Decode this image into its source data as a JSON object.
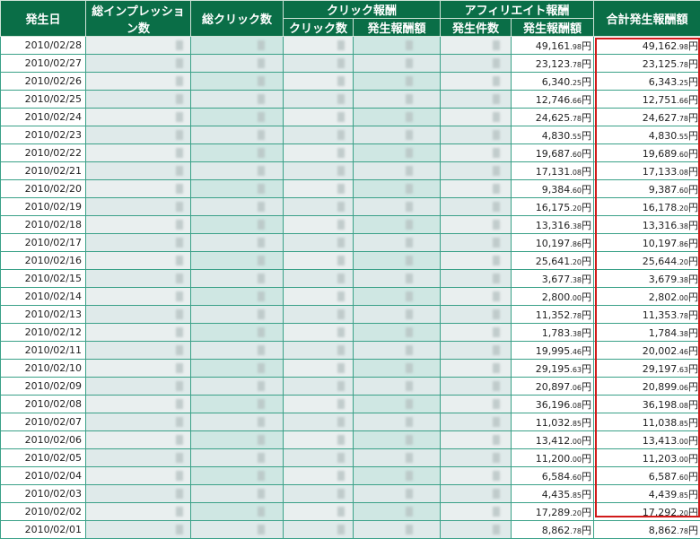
{
  "headers": {
    "date": "発生日",
    "impressions": "総インプレッション数",
    "clicks": "総クリック数",
    "click_reward": "クリック報酬",
    "click_count": "クリック数",
    "click_amount": "発生報酬額",
    "affiliate_reward": "アフィリエイト報酬",
    "affiliate_count": "発生件数",
    "affiliate_amount": "発生報酬額",
    "total_amount": "合計発生報酬額"
  },
  "currency": "円",
  "rows": [
    {
      "date": "2010/02/28",
      "aff_int": "49,161",
      "aff_dec": ".98",
      "tot_int": "49,162",
      "tot_dec": ".98"
    },
    {
      "date": "2010/02/27",
      "aff_int": "23,123",
      "aff_dec": ".78",
      "tot_int": "23,125",
      "tot_dec": ".78"
    },
    {
      "date": "2010/02/26",
      "aff_int": "6,340",
      "aff_dec": ".25",
      "tot_int": "6,343",
      "tot_dec": ".25"
    },
    {
      "date": "2010/02/25",
      "aff_int": "12,746",
      "aff_dec": ".66",
      "tot_int": "12,751",
      "tot_dec": ".66"
    },
    {
      "date": "2010/02/24",
      "aff_int": "24,625",
      "aff_dec": ".78",
      "tot_int": "24,627",
      "tot_dec": ".78"
    },
    {
      "date": "2010/02/23",
      "aff_int": "4,830",
      "aff_dec": ".55",
      "tot_int": "4,830",
      "tot_dec": ".55"
    },
    {
      "date": "2010/02/22",
      "aff_int": "19,687",
      "aff_dec": ".60",
      "tot_int": "19,689",
      "tot_dec": ".60"
    },
    {
      "date": "2010/02/21",
      "aff_int": "17,131",
      "aff_dec": ".08",
      "tot_int": "17,133",
      "tot_dec": ".08"
    },
    {
      "date": "2010/02/20",
      "aff_int": "9,384",
      "aff_dec": ".60",
      "tot_int": "9,387",
      "tot_dec": ".60"
    },
    {
      "date": "2010/02/19",
      "aff_int": "16,175",
      "aff_dec": ".20",
      "tot_int": "16,178",
      "tot_dec": ".20"
    },
    {
      "date": "2010/02/18",
      "aff_int": "13,316",
      "aff_dec": ".38",
      "tot_int": "13,316",
      "tot_dec": ".38"
    },
    {
      "date": "2010/02/17",
      "aff_int": "10,197",
      "aff_dec": ".86",
      "tot_int": "10,197",
      "tot_dec": ".86"
    },
    {
      "date": "2010/02/16",
      "aff_int": "25,641",
      "aff_dec": ".20",
      "tot_int": "25,644",
      "tot_dec": ".20"
    },
    {
      "date": "2010/02/15",
      "aff_int": "3,677",
      "aff_dec": ".38",
      "tot_int": "3,679",
      "tot_dec": ".38"
    },
    {
      "date": "2010/02/14",
      "aff_int": "2,800",
      "aff_dec": ".00",
      "tot_int": "2,802",
      "tot_dec": ".00"
    },
    {
      "date": "2010/02/13",
      "aff_int": "11,352",
      "aff_dec": ".78",
      "tot_int": "11,353",
      "tot_dec": ".78"
    },
    {
      "date": "2010/02/12",
      "aff_int": "1,783",
      "aff_dec": ".38",
      "tot_int": "1,784",
      "tot_dec": ".38"
    },
    {
      "date": "2010/02/11",
      "aff_int": "19,995",
      "aff_dec": ".46",
      "tot_int": "20,002",
      "tot_dec": ".46"
    },
    {
      "date": "2010/02/10",
      "aff_int": "29,195",
      "aff_dec": ".63",
      "tot_int": "29,197",
      "tot_dec": ".63"
    },
    {
      "date": "2010/02/09",
      "aff_int": "20,897",
      "aff_dec": ".06",
      "tot_int": "20,899",
      "tot_dec": ".06"
    },
    {
      "date": "2010/02/08",
      "aff_int": "36,196",
      "aff_dec": ".08",
      "tot_int": "36,198",
      "tot_dec": ".08"
    },
    {
      "date": "2010/02/07",
      "aff_int": "11,032",
      "aff_dec": ".85",
      "tot_int": "11,038",
      "tot_dec": ".85"
    },
    {
      "date": "2010/02/06",
      "aff_int": "13,412",
      "aff_dec": ".00",
      "tot_int": "13,413",
      "tot_dec": ".00"
    },
    {
      "date": "2010/02/05",
      "aff_int": "11,200",
      "aff_dec": ".00",
      "tot_int": "11,203",
      "tot_dec": ".00"
    },
    {
      "date": "2010/02/04",
      "aff_int": "6,584",
      "aff_dec": ".60",
      "tot_int": "6,587",
      "tot_dec": ".60"
    },
    {
      "date": "2010/02/03",
      "aff_int": "4,435",
      "aff_dec": ".85",
      "tot_int": "4,439",
      "tot_dec": ".85"
    },
    {
      "date": "2010/02/02",
      "aff_int": "17,289",
      "aff_dec": ".20",
      "tot_int": "17,292",
      "tot_dec": ".20"
    },
    {
      "date": "2010/02/01",
      "aff_int": "8,862",
      "aff_dec": ".78",
      "tot_int": "8,862",
      "tot_dec": ".78"
    }
  ],
  "colors": {
    "header_bg": "#0a6e47",
    "header_text": "#ffffff",
    "grid_line": "#3aa188",
    "highlight_box": "#d11a1a"
  }
}
